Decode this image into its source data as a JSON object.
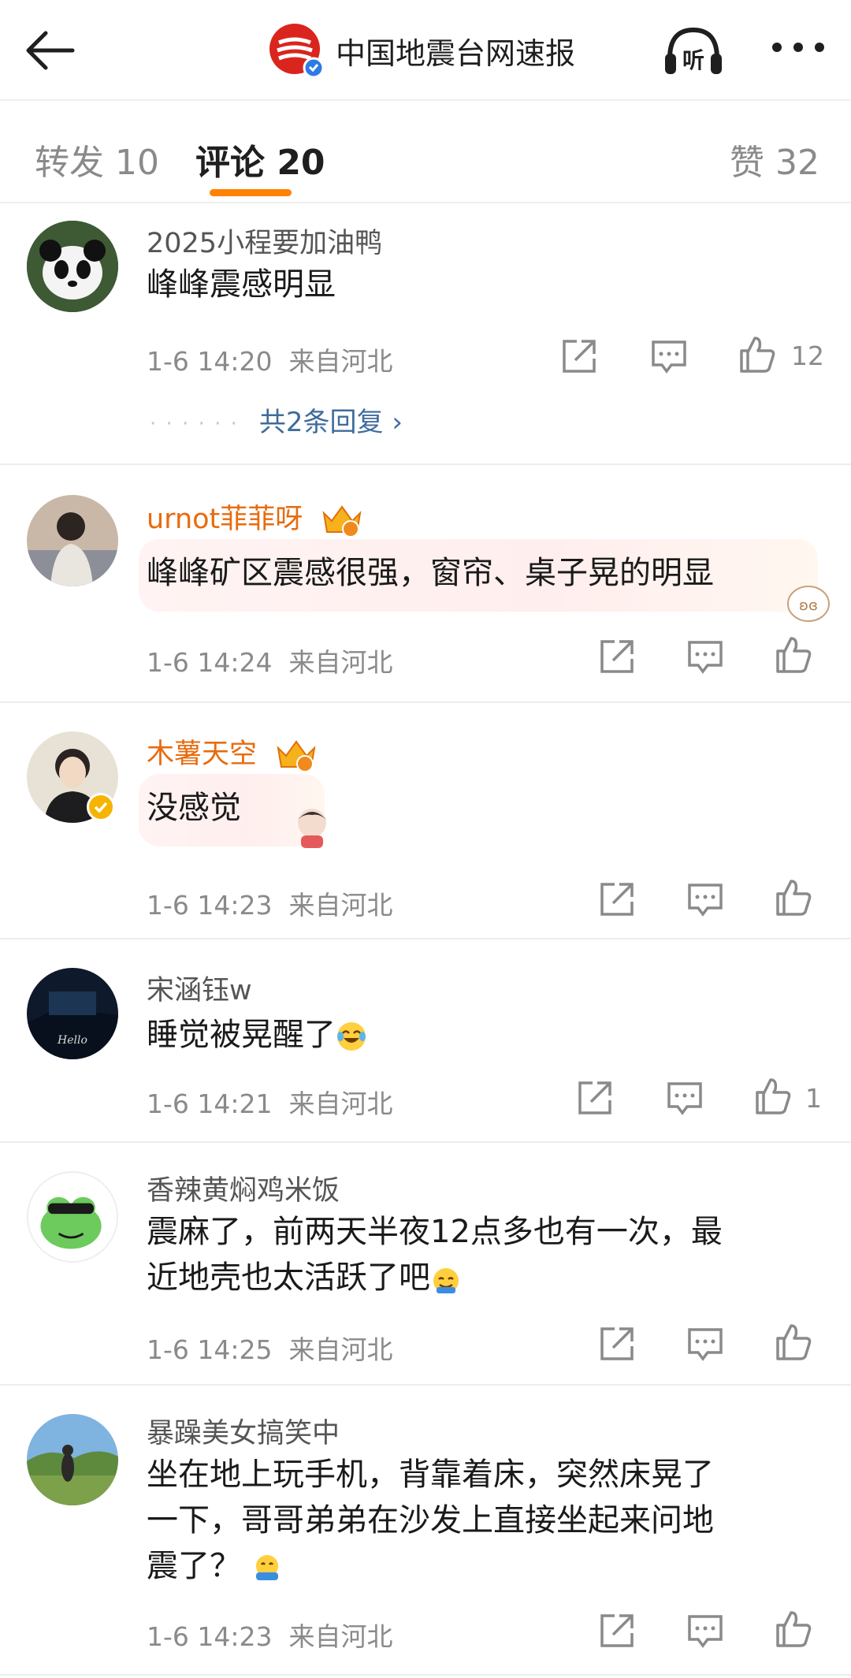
{
  "header": {
    "account_name": "中国地震台网速报",
    "logo_text": "三",
    "listen_label": "听"
  },
  "tabs": {
    "repost": "转发 10",
    "comments": "评论 20",
    "likes": "赞 32"
  },
  "comments": [
    {
      "user": "2025小程要加油鸭",
      "text": "峰峰震感明显",
      "time": "1-6 14:20",
      "location": "来自河北",
      "likes": "12",
      "replies": "共2条回复"
    },
    {
      "user": "urnot菲菲呀",
      "text": "峰峰矿区震感很强，窗帘、桌子晃的明显",
      "time": "1-6 14:24",
      "location": "来自河北",
      "likes": ""
    },
    {
      "user": "木薯天空",
      "text": "没感觉",
      "time": "1-6 14:23",
      "location": "来自河北",
      "likes": ""
    },
    {
      "user": "宋涵钰w",
      "text": "睡觉被晃醒了",
      "time": "1-6 14:21",
      "location": "来自河北",
      "likes": "1"
    },
    {
      "user": "香辣黄焖鸡米饭",
      "text_line1": "震麻了，前两天半夜12点多也有一次，最",
      "text_line2": "近地壳也太活跃了吧",
      "time": "1-6 14:25",
      "location": "来自河北",
      "likes": ""
    },
    {
      "user": "暴躁美女搞笑中",
      "text_line1": "坐在地上玩手机，背靠着床，突然床晃了",
      "text_line2": "一下，哥哥弟弟在沙发上直接坐起来问地",
      "text_line3": "震了？",
      "time": "1-6 14:23",
      "location": "来自河北",
      "likes": ""
    }
  ],
  "icons": [
    "back-arrow-icon",
    "listen-icon",
    "more-icon",
    "share-icon",
    "comment-icon",
    "like-icon",
    "crown-badge-icon",
    "verified-badge-icon"
  ],
  "colors": {
    "accent": "#ff8200",
    "vip_name": "#e86b0e",
    "link": "#3f6c9c",
    "meta": "#8a8a8a"
  }
}
